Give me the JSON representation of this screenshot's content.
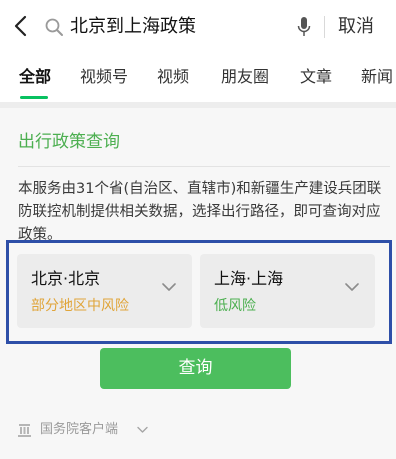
{
  "search": {
    "query": "北京到上海政策",
    "cancel_label": "取消"
  },
  "tabs": [
    {
      "label": "全部",
      "active": true
    },
    {
      "label": "视频号",
      "active": false
    },
    {
      "label": "视频",
      "active": false
    },
    {
      "label": "朋友圈",
      "active": false
    },
    {
      "label": "文章",
      "active": false
    },
    {
      "label": "新闻",
      "active": false
    }
  ],
  "card": {
    "title": "出行政策查询",
    "description": "本服务由31个省(自治区、直辖市)和新疆生产建设兵团联防联控机制提供相关数据，选择出行路径，即可查询对应政策。",
    "origin": {
      "city": "北京·北京",
      "risk": "部分地区中风险",
      "risk_color": "#e0a53a"
    },
    "destination": {
      "city": "上海·上海",
      "risk": "低风险",
      "risk_color": "#4caf50"
    },
    "query_button": "查询",
    "source": "国务院客户端"
  },
  "colors": {
    "accent_green": "#4cbe5e",
    "tab_indicator": "#07c160",
    "highlight_frame": "#2e4fa8"
  },
  "icons": [
    "back-arrow-icon",
    "search-icon",
    "microphone-icon",
    "chevron-down-icon",
    "government-icon"
  ]
}
